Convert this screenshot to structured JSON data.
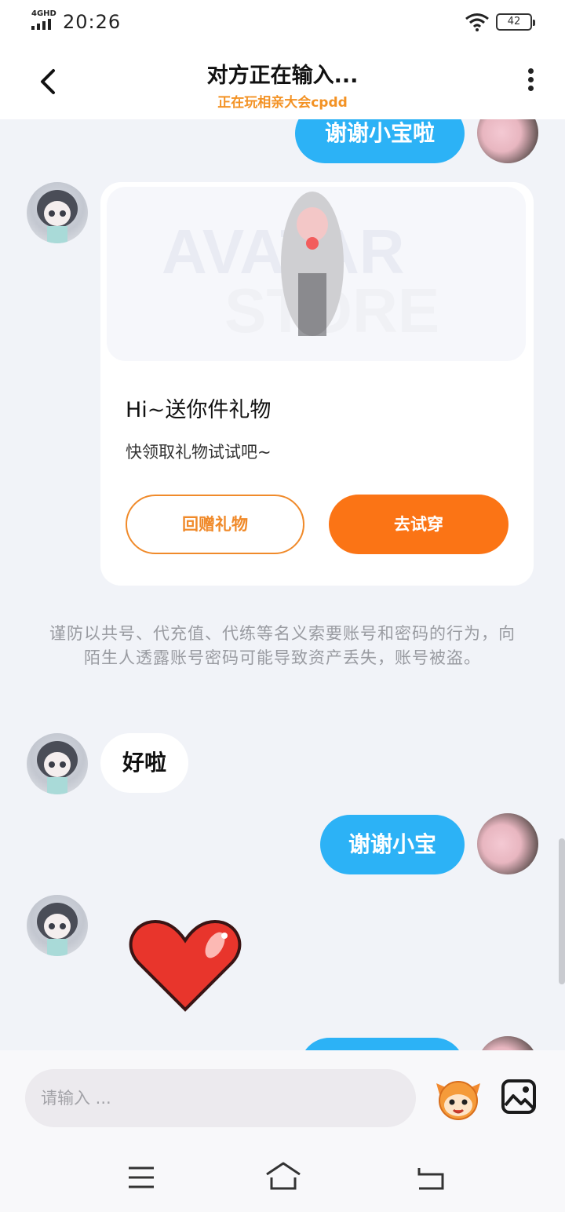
{
  "status_bar": {
    "network": "4GHD",
    "time": "20:26",
    "battery": "42"
  },
  "header": {
    "title": "对方正在输入...",
    "subtitle": "正在玩相亲大会cpdd"
  },
  "messages": [
    {
      "from": "self",
      "text": "谢谢小宝啦"
    },
    {
      "from": "other",
      "type": "gift_card",
      "title": "Hi~送你件礼物",
      "description": "快领取礼物试试吧~",
      "return_button": "回赠礼物",
      "try_button": "去试穿"
    },
    {
      "type": "notice",
      "text": "谨防以共号、代充值、代练等名义索要账号和密码的行为，向陌生人透露账号密码可能导致资产丢失，账号被盗。"
    },
    {
      "from": "other",
      "text": "好啦"
    },
    {
      "from": "self",
      "text": "谢谢小宝"
    },
    {
      "from": "other",
      "type": "sticker",
      "icon": "red-heart-icon"
    },
    {
      "from": "self",
      "type": "partial_bubble"
    }
  ],
  "input": {
    "placeholder": "请输入 ..."
  },
  "colors": {
    "accent_blue": "#2cb2f6",
    "accent_orange": "#fb7415",
    "subtitle_orange": "#f39224",
    "background": "#f1f3f8"
  },
  "icons": {
    "back": "back-arrow-icon",
    "more": "more-vertical-icon",
    "emoji": "mascot-emoji-icon",
    "image": "image-icon",
    "nav_menu": "menu-lines-icon",
    "nav_home": "home-icon",
    "nav_back": "return-icon"
  }
}
